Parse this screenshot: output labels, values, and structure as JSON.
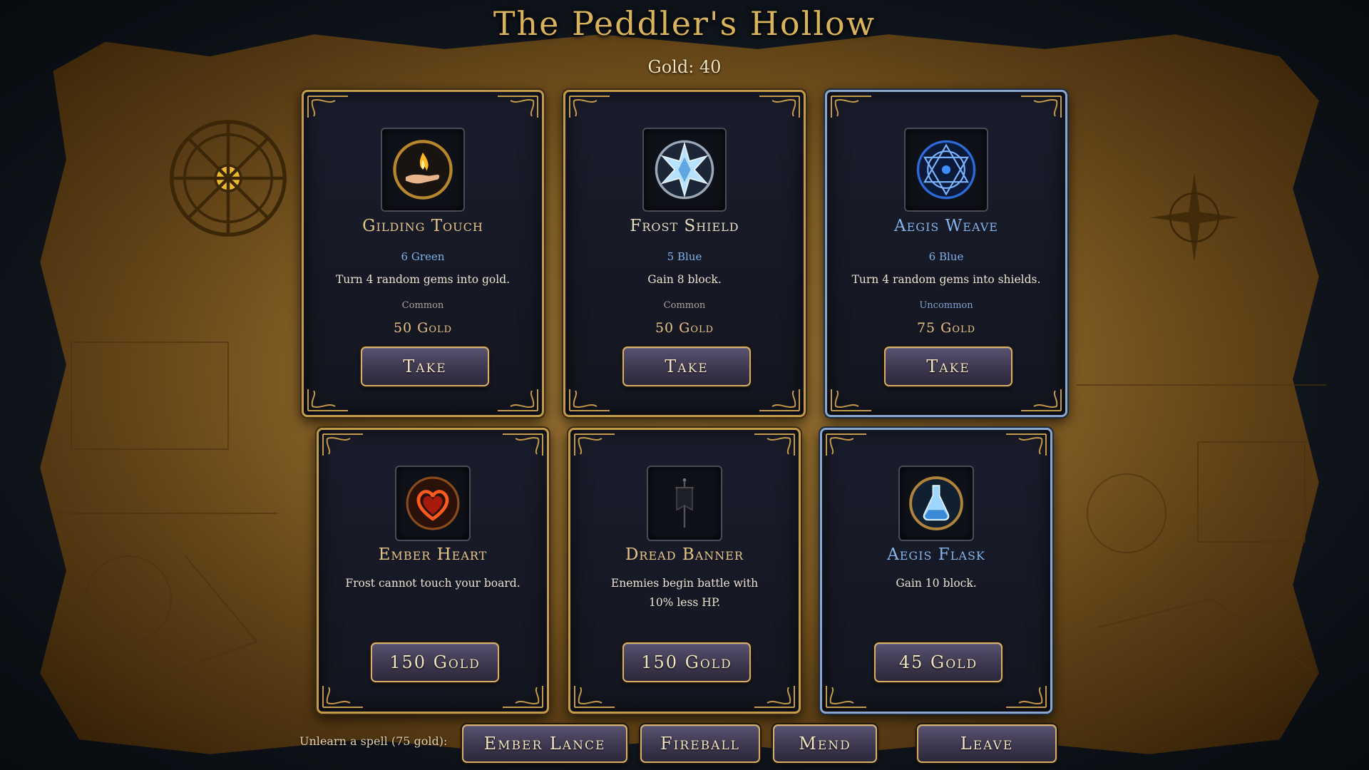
{
  "shop": {
    "title": "The Peddler's Hollow",
    "gold_label": "Gold: 40"
  },
  "spells": [
    {
      "name": "Gilding Touch",
      "cost": "6 Green",
      "description": "Turn 4 random gems into gold.",
      "rarity": "Common",
      "price": "50 Gold",
      "button": "Take",
      "icon": "flame-in-hand-icon"
    },
    {
      "name": "Frost Shield",
      "cost": "5 Blue",
      "description": "Gain 8 block.",
      "rarity": "Common",
      "price": "50 Gold",
      "button": "Take",
      "icon": "ice-crystal-icon"
    },
    {
      "name": "Aegis Weave",
      "cost": "6 Blue",
      "description": "Turn 4 random gems into shields.",
      "rarity": "Uncommon",
      "price": "75 Gold",
      "button": "Take",
      "icon": "arcane-sigil-icon"
    }
  ],
  "relics": [
    {
      "name": "Ember Heart",
      "description": "Frost cannot touch your board.",
      "button": "150 Gold",
      "icon": "flaming-heart-icon"
    },
    {
      "name": "Dread Banner",
      "description": "Enemies begin battle with 10% less HP.",
      "button": "150 Gold",
      "icon": "war-banner-icon"
    },
    {
      "name": "Aegis Flask",
      "description": "Gain 10 block.",
      "button": "45 Gold",
      "icon": "potion-flask-icon"
    }
  ],
  "footer": {
    "unlearn_label": "Unlearn a spell (75 gold):",
    "unlearn_options": [
      "Ember Lance",
      "Fireball",
      "Mend"
    ],
    "leave_label": "Leave"
  },
  "colors": {
    "gold_accent": "#d6b06a",
    "blue_accent": "#84b4ea",
    "card_bg": "#14161f"
  }
}
